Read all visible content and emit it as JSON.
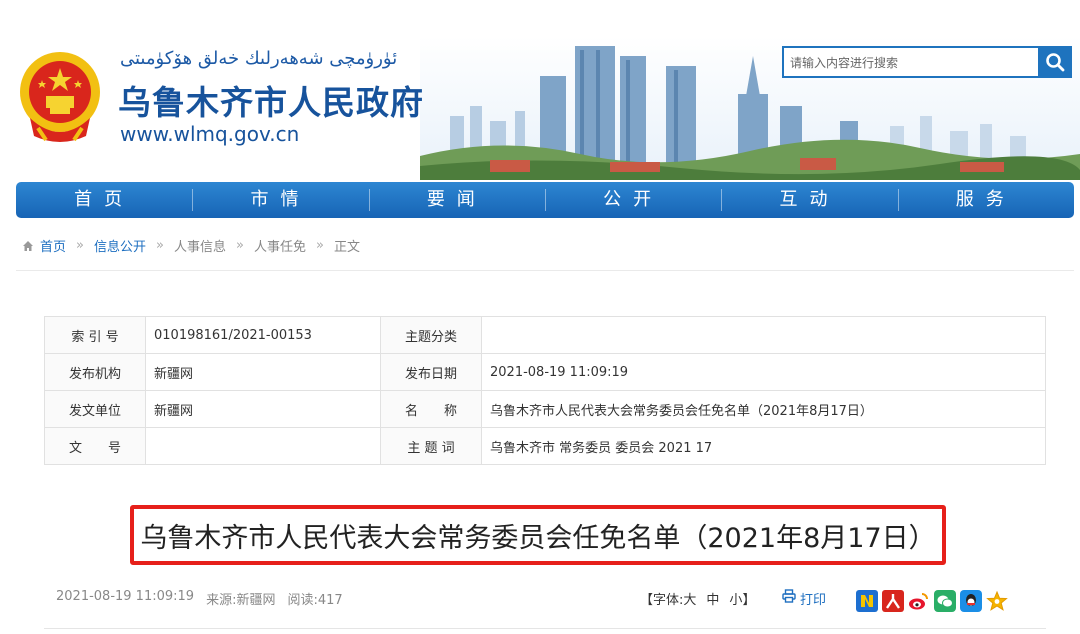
{
  "header": {
    "site_name_uyghur": "ئۈرۈمچى شەھەرلىك خەلق ھۆكۈمىتى",
    "site_name": "乌鲁木齐市人民政府",
    "site_url": "www.wlmq.gov.cn",
    "search_placeholder": "请输入内容进行搜索"
  },
  "nav": [
    "首页",
    "市情",
    "要闻",
    "公开",
    "互动",
    "服务"
  ],
  "breadcrumb": {
    "home": "首页",
    "items": [
      "信息公开",
      "人事信息",
      "人事任免",
      "正文"
    ],
    "separator": "»"
  },
  "meta": {
    "rows": [
      {
        "k1": "索 引 号",
        "v1": "010198161/2021-00153",
        "k2": "主题分类",
        "v2": ""
      },
      {
        "k1": "发布机构",
        "v1": "新疆网",
        "k2": "发布日期",
        "v2": "2021-08-19 11:09:19"
      },
      {
        "k1": "发文单位",
        "v1": "新疆网",
        "k2": "名　　称",
        "v2": "乌鲁木齐市人民代表大会常务委员会任免名单（2021年8月17日）"
      },
      {
        "k1": "文　　号",
        "v1": "",
        "k2": "主 题 词",
        "v2": "乌鲁木齐市 常务委员 委员会 2021 17"
      }
    ]
  },
  "article": {
    "title": "乌鲁木齐市人民代表大会常务委员会任免名单（2021年8月17日）",
    "date": "2021-08-19 11:09:19",
    "source": "来源:新疆网",
    "views": "阅读:417"
  },
  "tools": {
    "font_open": "【字体:",
    "font_large": "大",
    "font_medium": "中",
    "font_small": "小",
    "font_close": "】",
    "print": "打印"
  },
  "colors": {
    "primary": "#1e73be",
    "nav_top": "#2d86d2",
    "nav_bottom": "#1764b5",
    "highlight_box": "#e6201a",
    "title_blue": "#17539c"
  },
  "share_icons": [
    "news-icon",
    "people-daily-icon",
    "weibo-icon",
    "wechat-icon",
    "qq-icon",
    "favorite-star-icon"
  ]
}
